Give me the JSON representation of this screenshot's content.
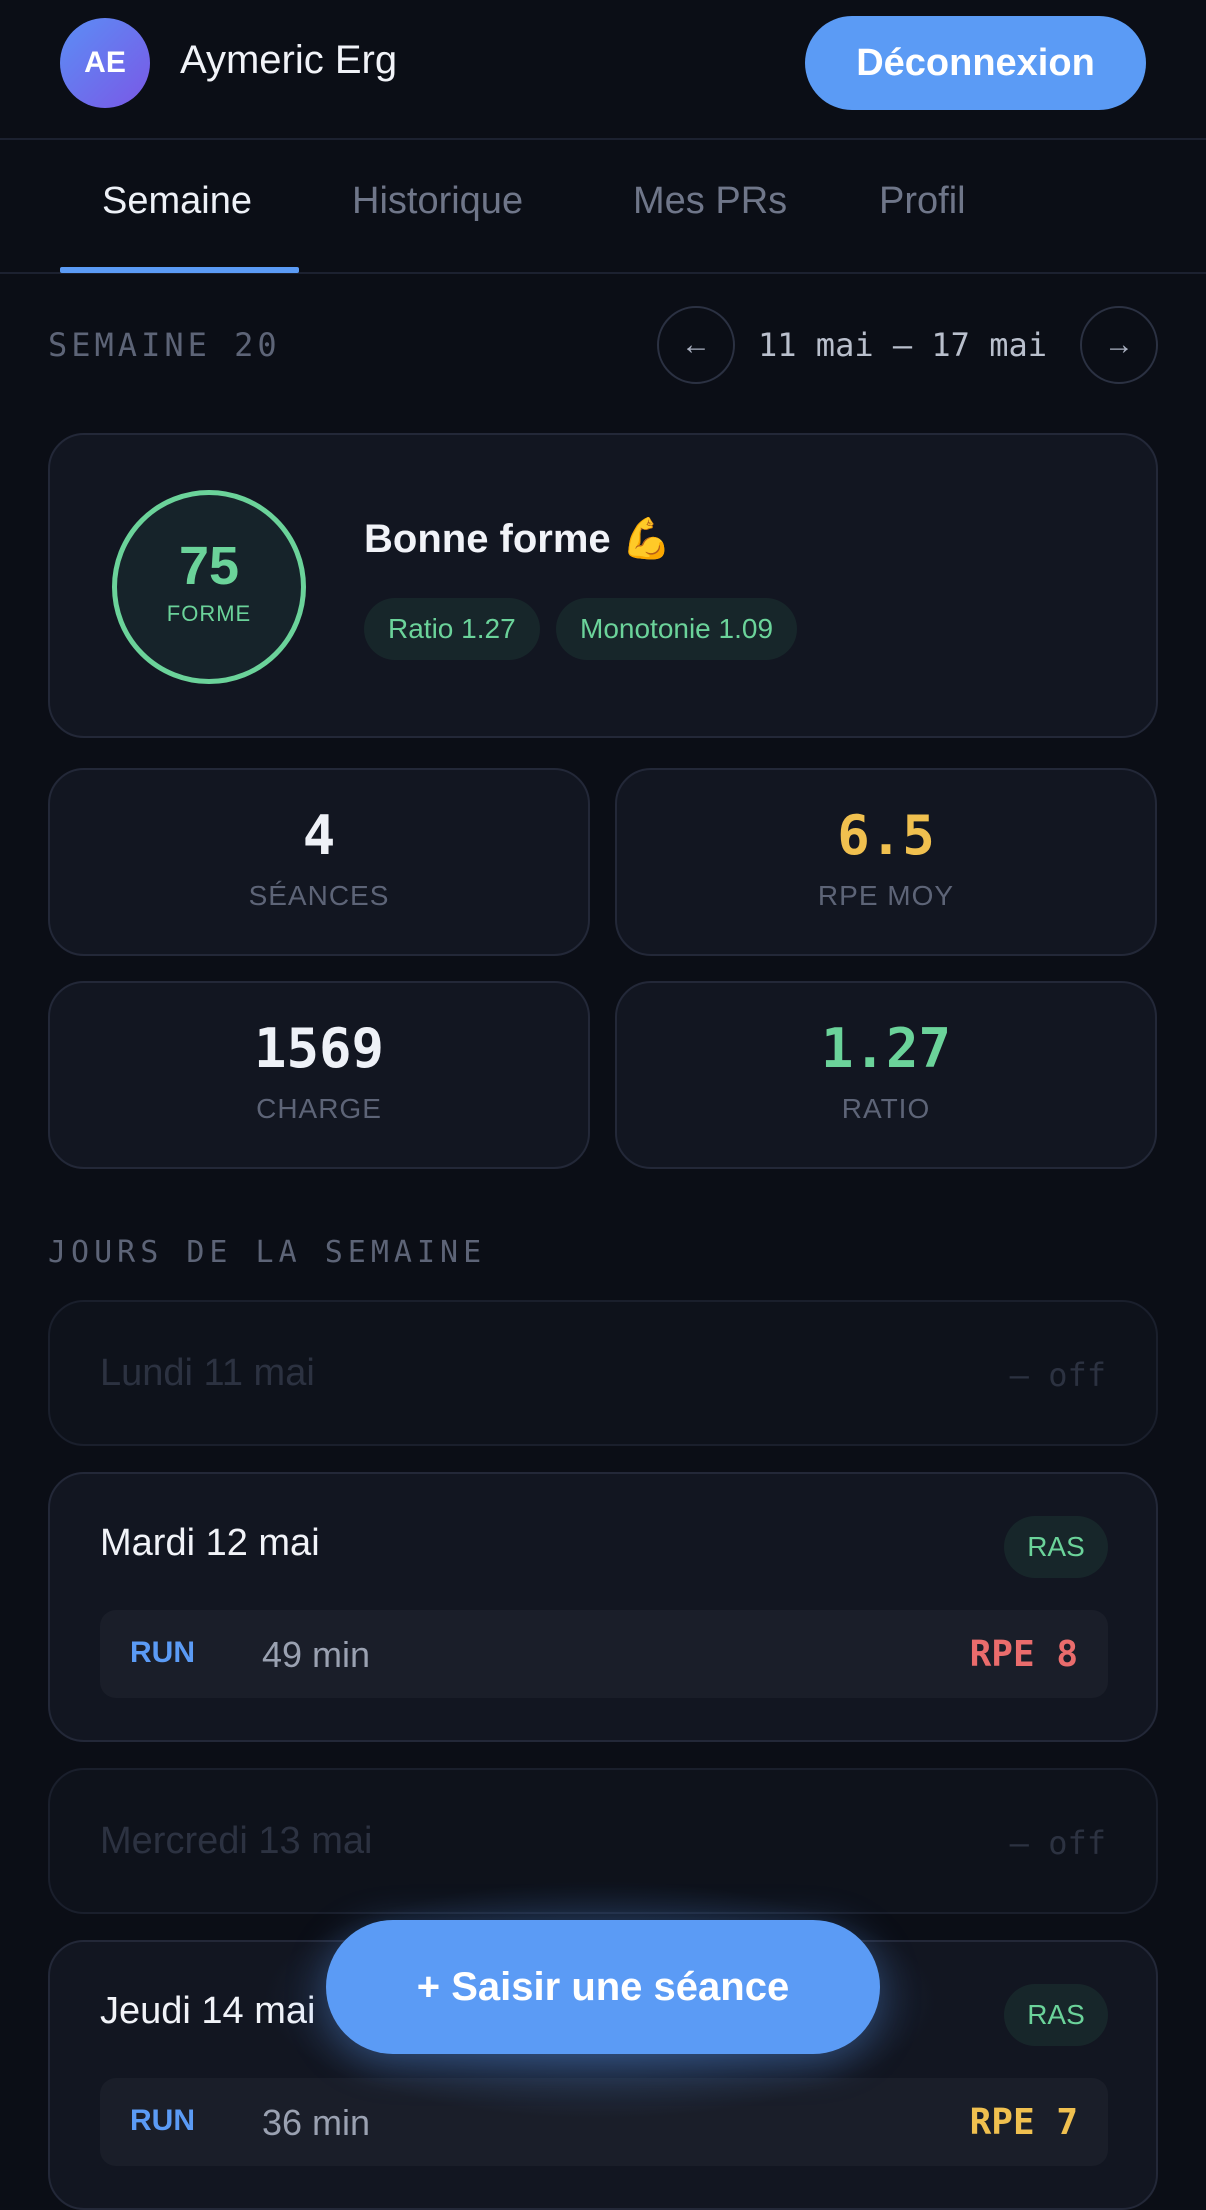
{
  "header": {
    "avatar_initials": "AE",
    "username": "Aymeric Erg",
    "logout_label": "Déconnexion"
  },
  "tabs": [
    {
      "label": "Semaine",
      "active": true
    },
    {
      "label": "Historique",
      "active": false
    },
    {
      "label": "Mes PRs",
      "active": false
    },
    {
      "label": "Profil",
      "active": false
    }
  ],
  "week": {
    "label": "SEMAINE 20",
    "range": "11 mai — 17 mai",
    "prev_icon": "arrow-left-icon",
    "next_icon": "arrow-right-icon"
  },
  "forme": {
    "score": "75",
    "score_label": "FORME",
    "title": "Bonne forme 💪",
    "ratio_pill": "Ratio 1.27",
    "monotonie_pill": "Monotonie 1.09"
  },
  "stats": [
    {
      "value": "4",
      "label": "SÉANCES",
      "color": "#eef1f7"
    },
    {
      "value": "6.5",
      "label": "RPE MOY",
      "color": "#f0c04f"
    },
    {
      "value": "1569",
      "label": "CHARGE",
      "color": "#eef1f7"
    },
    {
      "value": "1.27",
      "label": "RATIO",
      "color": "#6bd39a"
    }
  ],
  "days_section_title": "JOURS DE LA SEMAINE",
  "days": [
    {
      "name": "Lundi 11 mai",
      "status": "— off"
    },
    {
      "name": "Mardi 12 mai",
      "badge": "RAS",
      "session": {
        "sport": "RUN",
        "duration": "49 min",
        "rpe": "RPE 8",
        "rpe_color": "#ea6c6c"
      }
    },
    {
      "name": "Mercredi 13 mai",
      "status": "— off"
    },
    {
      "name": "Jeudi 14 mai",
      "badge": "RAS",
      "session": {
        "sport": "RUN",
        "duration": "36 min",
        "rpe": "RPE 7",
        "rpe_color": "#f0c04f"
      }
    }
  ],
  "fab_label": "+ Saisir une séance",
  "colors": {
    "accent": "#5b9bf5",
    "good": "#6bd39a",
    "warn": "#f0c04f",
    "danger": "#ea6c6c",
    "background": "#0b0e16"
  }
}
